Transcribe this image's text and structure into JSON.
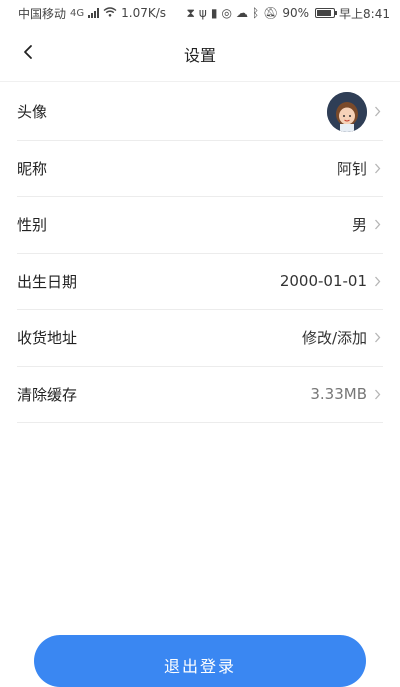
{
  "status_bar": {
    "carrier": "中国移动",
    "net_speed": "1.07K/s",
    "battery": "90%",
    "time": "早上8:41"
  },
  "header": {
    "title": "设置"
  },
  "settings": [
    {
      "key": "avatar",
      "label": "头像",
      "value": ""
    },
    {
      "key": "nickname",
      "label": "昵称",
      "value": "阿钊"
    },
    {
      "key": "gender",
      "label": "性别",
      "value": "男"
    },
    {
      "key": "birthday",
      "label": "出生日期",
      "value": "2000-01-01"
    },
    {
      "key": "address",
      "label": "收货地址",
      "value": "修改/添加"
    },
    {
      "key": "cache",
      "label": "清除缓存",
      "value": "3.33MB"
    }
  ],
  "logout": {
    "label": "退出登录"
  },
  "colors": {
    "accent": "#3a87f2",
    "divider": "#ececec"
  }
}
